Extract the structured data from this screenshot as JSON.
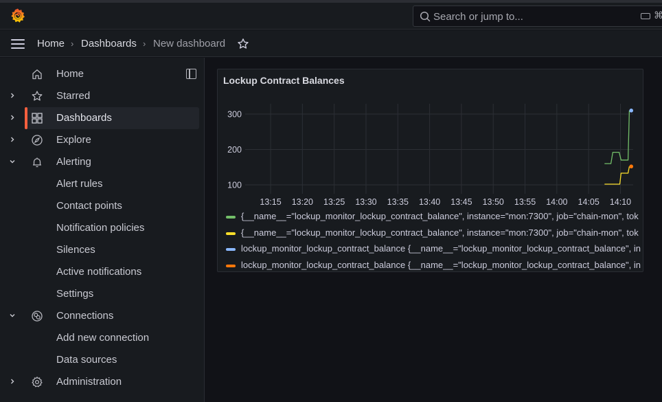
{
  "topbar": {
    "search_placeholder": "Search or jump to...",
    "shortcut_glyph": "⌘"
  },
  "breadcrumb": [
    {
      "label": "Home"
    },
    {
      "label": "Dashboards"
    },
    {
      "label": "New dashboard"
    }
  ],
  "sidebar": {
    "items": [
      {
        "label": "Home",
        "icon": "home-icon",
        "chevron": "none"
      },
      {
        "label": "Starred",
        "icon": "star-icon",
        "chevron": "right"
      },
      {
        "label": "Dashboards",
        "icon": "apps-icon",
        "chevron": "right",
        "active": true
      },
      {
        "label": "Explore",
        "icon": "compass-icon",
        "chevron": "right"
      },
      {
        "label": "Alerting",
        "icon": "bell-icon",
        "chevron": "down"
      },
      {
        "label": "Alert rules"
      },
      {
        "label": "Contact points"
      },
      {
        "label": "Notification policies"
      },
      {
        "label": "Silences"
      },
      {
        "label": "Active notifications"
      },
      {
        "label": "Settings"
      },
      {
        "label": "Connections",
        "icon": "connections-icon",
        "chevron": "down"
      },
      {
        "label": "Add new connection"
      },
      {
        "label": "Data sources"
      },
      {
        "label": "Administration",
        "icon": "gear-icon",
        "chevron": "right"
      }
    ]
  },
  "colors": {
    "accent": "#f55f3e",
    "series_green": "#73bf69",
    "series_yellow": "#fade2a",
    "series_blue": "#8ab8ff",
    "series_orange": "#ff780a"
  },
  "panel": {
    "title": "Lockup Contract Balances"
  },
  "chart_data": {
    "type": "line",
    "title": "Lockup Contract Balances",
    "xlabel": "",
    "ylabel": "",
    "x_tick_labels": [
      "13:15",
      "13:20",
      "13:25",
      "13:30",
      "13:35",
      "13:40",
      "13:45",
      "13:50",
      "13:55",
      "14:00",
      "14:05",
      "14:10"
    ],
    "x_range_minutes": [
      "13:11",
      "14:12"
    ],
    "y_ticks": [
      100,
      200,
      300
    ],
    "ylim": [
      75,
      330
    ],
    "grid": true,
    "legend_position": "bottom",
    "series": [
      {
        "name": "{__name__=\"lockup_monitor_lockup_contract_balance\", instance=\"mon:7300\", job=\"chain-mon\", tok",
        "color": "#73bf69",
        "points": [
          [
            "14:07.5",
            160
          ],
          [
            "14:08.5",
            160
          ],
          [
            "14:08.8",
            192
          ],
          [
            "14:09.8",
            192
          ],
          [
            "14:10.1",
            170
          ],
          [
            "14:11.2",
            170
          ],
          [
            "14:11.4",
            310
          ]
        ]
      },
      {
        "name": "{__name__=\"lockup_monitor_lockup_contract_balance\", instance=\"mon:7300\", job=\"chain-mon\", tok",
        "color": "#fade2a",
        "points": [
          [
            "14:07.5",
            102
          ],
          [
            "14:09.9",
            102
          ],
          [
            "14:10.1",
            133
          ],
          [
            "14:11.2",
            133
          ],
          [
            "14:11.4",
            152
          ]
        ]
      },
      {
        "name": "lockup_monitor_lockup_contract_balance {__name__=\"lockup_monitor_lockup_contract_balance\", in",
        "color": "#8ab8ff",
        "points": [
          [
            "14:11.7",
            310
          ]
        ]
      },
      {
        "name": "lockup_monitor_lockup_contract_balance {__name__=\"lockup_monitor_lockup_contract_balance\", in",
        "color": "#ff780a",
        "points": [
          [
            "14:11.7",
            152
          ]
        ]
      }
    ]
  }
}
